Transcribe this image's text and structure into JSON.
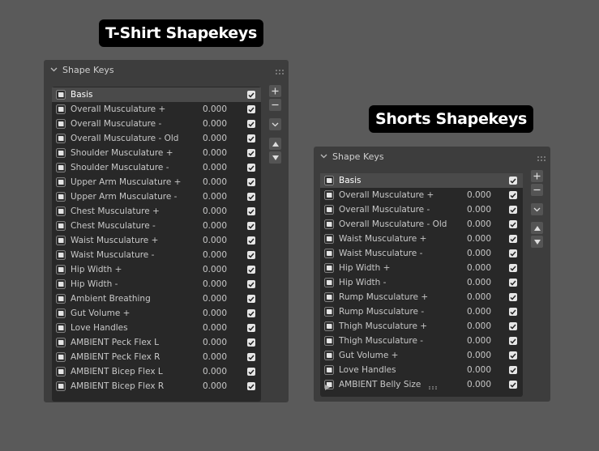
{
  "left": {
    "badge": "T-Shirt Shapekeys",
    "panel_title": "Shape Keys",
    "keys": [
      {
        "name": "Basis",
        "value": ""
      },
      {
        "name": "Overall Musculature +",
        "value": "0.000"
      },
      {
        "name": "Overall Musculature -",
        "value": "0.000"
      },
      {
        "name": "Overall Musculature - Old",
        "value": "0.000"
      },
      {
        "name": "Shoulder Musculature +",
        "value": "0.000"
      },
      {
        "name": "Shoulder Musculature -",
        "value": "0.000"
      },
      {
        "name": "Upper Arm Musculature +",
        "value": "0.000"
      },
      {
        "name": "Upper Arm Musculature -",
        "value": "0.000"
      },
      {
        "name": "Chest Musculature +",
        "value": "0.000"
      },
      {
        "name": "Chest Musculature -",
        "value": "0.000"
      },
      {
        "name": "Waist Musculature +",
        "value": "0.000"
      },
      {
        "name": "Waist Musculature -",
        "value": "0.000"
      },
      {
        "name": "Hip Width +",
        "value": "0.000"
      },
      {
        "name": "Hip Width -",
        "value": "0.000"
      },
      {
        "name": "Ambient Breathing",
        "value": "0.000"
      },
      {
        "name": "Gut Volume +",
        "value": "0.000"
      },
      {
        "name": "Love Handles",
        "value": "0.000"
      },
      {
        "name": "AMBIENT Peck Flex L",
        "value": "0.000"
      },
      {
        "name": "AMBIENT Peck Flex R",
        "value": "0.000"
      },
      {
        "name": "AMBIENT Bicep Flex L",
        "value": "0.000"
      },
      {
        "name": "AMBIENT Bicep Flex R",
        "value": "0.000"
      }
    ]
  },
  "right": {
    "badge": "Shorts Shapekeys",
    "panel_title": "Shape Keys",
    "keys": [
      {
        "name": "Basis",
        "value": ""
      },
      {
        "name": "Overall Musculature +",
        "value": "0.000"
      },
      {
        "name": "Overall Musculature -",
        "value": "0.000"
      },
      {
        "name": "Overall Musculature - Old",
        "value": "0.000"
      },
      {
        "name": "Waist Musculature +",
        "value": "0.000"
      },
      {
        "name": "Waist Musculature -",
        "value": "0.000"
      },
      {
        "name": "Hip Width +",
        "value": "0.000"
      },
      {
        "name": "Hip Width -",
        "value": "0.000"
      },
      {
        "name": "Rump Musculature +",
        "value": "0.000"
      },
      {
        "name": "Rump Musculature -",
        "value": "0.000"
      },
      {
        "name": "Thigh Musculature +",
        "value": "0.000"
      },
      {
        "name": "Thigh Musculature -",
        "value": "0.000"
      },
      {
        "name": "Gut Volume +",
        "value": "0.000"
      },
      {
        "name": "Love Handles",
        "value": "0.000"
      },
      {
        "name": "AMBIENT Belly Size",
        "value": "0.000"
      }
    ]
  },
  "icons": {
    "shapekey": "shape-key-icon",
    "add": "plus-icon",
    "remove": "minus-icon",
    "specials": "chevron-down-icon",
    "move_up": "triangle-up-icon",
    "move_down": "triangle-down-icon",
    "checkbox": "checkbox-checked-icon",
    "collapse": "chevron-down-icon",
    "drag": "grip-icon"
  },
  "colors": {
    "background": "#5a5a5a",
    "panel": "#3d3d3d",
    "list": "#282828",
    "selected_row": "#4a4a4a",
    "badge": "#000000"
  }
}
